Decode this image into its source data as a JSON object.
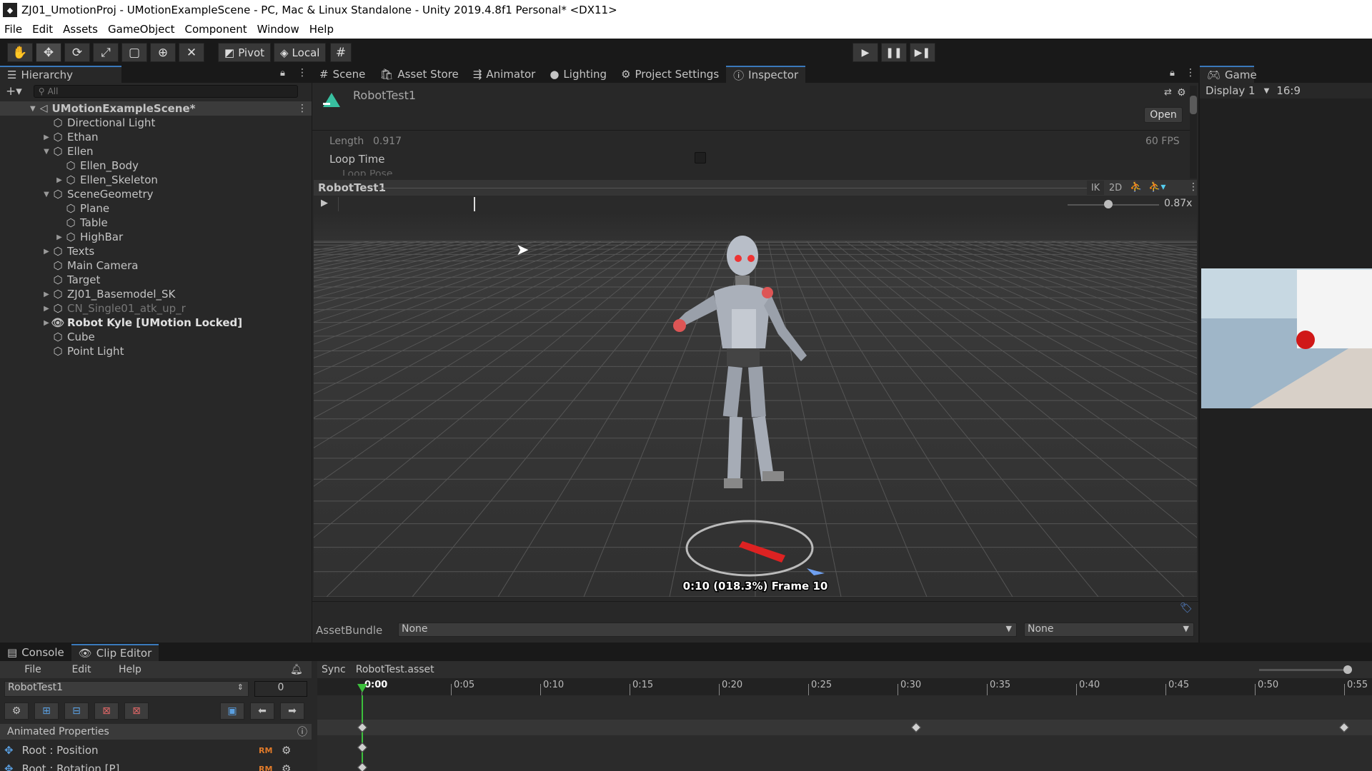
{
  "window": {
    "title": "ZJ01_UmotionProj - UMotionExampleScene - PC, Mac & Linux Standalone - Unity 2019.4.8f1 Personal* <DX11>"
  },
  "menu": [
    "File",
    "Edit",
    "Assets",
    "GameObject",
    "Component",
    "Window",
    "Help"
  ],
  "toolbar": {
    "pivot": "Pivot",
    "local": "Local"
  },
  "hierarchy": {
    "tab": "Hierarchy",
    "search_placeholder": "All",
    "scene": "UMotionExampleScene*",
    "items": [
      {
        "label": "Directional Light",
        "depth": 1,
        "arrow": ""
      },
      {
        "label": "Ethan",
        "depth": 1,
        "arrow": "▶"
      },
      {
        "label": "Ellen",
        "depth": 1,
        "arrow": "▼"
      },
      {
        "label": "Ellen_Body",
        "depth": 2,
        "arrow": ""
      },
      {
        "label": "Ellen_Skeleton",
        "depth": 2,
        "arrow": "▶"
      },
      {
        "label": "SceneGeometry",
        "depth": 1,
        "arrow": "▼"
      },
      {
        "label": "Plane",
        "depth": 2,
        "arrow": ""
      },
      {
        "label": "Table",
        "depth": 2,
        "arrow": ""
      },
      {
        "label": "HighBar",
        "depth": 2,
        "arrow": "▶"
      },
      {
        "label": "Texts",
        "depth": 1,
        "arrow": "▶"
      },
      {
        "label": "Main Camera",
        "depth": 1,
        "arrow": ""
      },
      {
        "label": "Target",
        "depth": 1,
        "arrow": ""
      },
      {
        "label": "ZJ01_Basemodel_SK",
        "depth": 1,
        "arrow": "▶"
      },
      {
        "label": "CN_Single01_atk_up_r",
        "depth": 1,
        "arrow": "▶",
        "dim": true
      },
      {
        "label": "Robot Kyle [UMotion Locked]",
        "depth": 1,
        "arrow": "▶",
        "bold": true
      },
      {
        "label": "Cube",
        "depth": 1,
        "arrow": ""
      },
      {
        "label": "Point Light",
        "depth": 1,
        "arrow": ""
      }
    ]
  },
  "center_tabs": [
    "Scene",
    "Asset Store",
    "Animator",
    "Lighting",
    "Project Settings",
    "Inspector"
  ],
  "inspector": {
    "asset_name": "RobotTest1",
    "open_button": "Open",
    "length_label": "Length",
    "length_value": "0.917",
    "fps": "60 FPS",
    "loop_time": "Loop Time",
    "loop_pose": "Loop Pose",
    "preview_title": "RobotTest1",
    "ik": "IK",
    "two_d": "2D",
    "speed": "0.87x",
    "speed_fraction": 0.4,
    "frame_info": "0:10 (018.3%) Frame 10",
    "assetbundle_label": "AssetBundle",
    "assetbundle_value": "None",
    "assetbundle_variant": "None"
  },
  "game": {
    "tab": "Game",
    "display": "Display 1",
    "aspect": "16:9"
  },
  "bottom": {
    "tabs": [
      "Console",
      "Clip Editor"
    ],
    "menu": [
      "File",
      "Edit",
      "Help"
    ],
    "clip": "RobotTest1",
    "frame": "0",
    "sync": "Sync",
    "asset": "RobotTest.asset",
    "animated_properties": "Animated Properties",
    "properties": [
      {
        "label": "Root : Position",
        "tag": "RM"
      },
      {
        "label": "Root : Rotation [P]",
        "tag": "RM"
      }
    ],
    "ruler": [
      "0:00",
      "0:05",
      "0:10",
      "0:15",
      "0:20",
      "0:25",
      "0:30",
      "0:35",
      "0:40",
      "0:45",
      "0:50",
      "0:55"
    ]
  },
  "colors": {
    "accent": "#3a79bb",
    "bg": "#282828",
    "dark": "#191919"
  }
}
